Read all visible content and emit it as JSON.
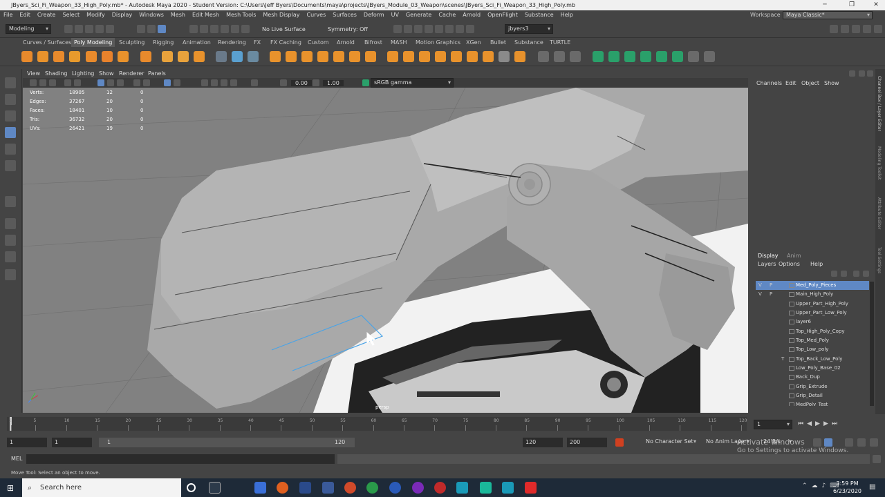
{
  "window": {
    "title": "JByers_Sci_Fi_Weapon_33_High_Poly.mb* - Autodesk Maya 2020 - Student Version: C:\\Users\\Jeff Byers\\Documents\\maya\\projects\\JByers_Module_03_Weapon\\scenes\\JByers_Sci_Fi_Weapon_33_High_Poly.mb",
    "minimize": "─",
    "maximize": "❐",
    "close": "✕"
  },
  "menu": [
    "File",
    "Edit",
    "Create",
    "Select",
    "Modify",
    "Display",
    "Windows",
    "Mesh",
    "Edit Mesh",
    "Mesh Tools",
    "Mesh Display",
    "Curves",
    "Surfaces",
    "Deform",
    "UV",
    "Generate",
    "Cache",
    "Arnold",
    "OpenFlight",
    "Substance",
    "Help"
  ],
  "workspace": {
    "label": "Workspace :",
    "value": "Maya Classic*"
  },
  "statusline": {
    "mode": "Modeling",
    "live_surface": "No Live Surface",
    "symmetry": "Symmetry: Off",
    "user": "jbyers3"
  },
  "shelf_tabs": [
    "Curves / Surfaces",
    "Poly Modeling",
    "Sculpting",
    "Rigging",
    "Animation",
    "Rendering",
    "FX",
    "FX Caching",
    "Custom",
    "Arnold",
    "Bifrost",
    "MASH",
    "Motion Graphics",
    "XGen",
    "Bullet",
    "Substance",
    "TURTLE"
  ],
  "panel_menu": [
    "View",
    "Shading",
    "Lighting",
    "Show",
    "Renderer",
    "Panels"
  ],
  "panel_tools": {
    "field1": "0.00",
    "field2": "1.00",
    "colorspace": "sRGB gamma"
  },
  "hud": [
    {
      "label": "Verts:",
      "a": "18905",
      "b": "12",
      "c": "0"
    },
    {
      "label": "Edges:",
      "a": "37267",
      "b": "20",
      "c": "0"
    },
    {
      "label": "Faces:",
      "a": "18401",
      "b": "10",
      "c": "0"
    },
    {
      "label": "Tris:",
      "a": "36732",
      "b": "20",
      "c": "0"
    },
    {
      "label": "UVs:",
      "a": "26421",
      "b": "19",
      "c": "0"
    }
  ],
  "camera_label": "persp",
  "channel_box": {
    "menu": [
      "Channels",
      "Edit",
      "Object",
      "Show"
    ]
  },
  "side_tabs": [
    "Channel Box / Layer Editor",
    "Modeling Toolkit",
    "Attribute Editor",
    "Tool Settings"
  ],
  "layer_editor": {
    "tabs": [
      "Display",
      "Anim"
    ],
    "menu": [
      "Layers",
      "Options",
      "Help"
    ],
    "layers": [
      {
        "v": "V",
        "p": "P",
        "t": "",
        "name": "Med_Poly_Pieces",
        "selected": true
      },
      {
        "v": "V",
        "p": "P",
        "t": "",
        "name": "Main_High_Poly"
      },
      {
        "v": "",
        "p": "",
        "t": "",
        "name": "Upper_Part_High_Poly"
      },
      {
        "v": "",
        "p": "",
        "t": "",
        "name": "Upper_Part_Low_Poly"
      },
      {
        "v": "",
        "p": "",
        "t": "",
        "name": "layer6"
      },
      {
        "v": "",
        "p": "",
        "t": "",
        "name": "Top_High_Poly_Copy"
      },
      {
        "v": "",
        "p": "",
        "t": "",
        "name": "Top_Med_Poly"
      },
      {
        "v": "",
        "p": "",
        "t": "",
        "name": "Top_Low_poly"
      },
      {
        "v": "",
        "p": "",
        "t": "T",
        "name": "Top_Back_Low_Poly"
      },
      {
        "v": "",
        "p": "",
        "t": "",
        "name": "Low_Poly_Base_02"
      },
      {
        "v": "",
        "p": "",
        "t": "",
        "name": "Back_Dup"
      },
      {
        "v": "",
        "p": "",
        "t": "",
        "name": "Grip_Extrude"
      },
      {
        "v": "",
        "p": "",
        "t": "",
        "name": "Grip_Detail"
      },
      {
        "v": "",
        "p": "",
        "t": "",
        "name": "MedPoly_Test"
      }
    ]
  },
  "timeline": {
    "ticks": [
      "1",
      "5",
      "10",
      "15",
      "20",
      "25",
      "30",
      "35",
      "40",
      "45",
      "50",
      "55",
      "60",
      "65",
      "70",
      "75",
      "80",
      "85",
      "90",
      "95",
      "100",
      "105",
      "110",
      "115",
      "120"
    ],
    "current": "1"
  },
  "range": {
    "start": "1",
    "start2": "1",
    "slider_start": "1",
    "slider_end": "120",
    "end": "120",
    "end2": "200",
    "character_set": "No Character Set",
    "anim_layer": "No Anim Layer",
    "fps": "24 fps"
  },
  "cmdline": {
    "label": "MEL"
  },
  "helpline": "Move Tool: Select an object to move.",
  "watermark": {
    "line1": "Activate Windows",
    "line2": "Go to Settings to activate Windows."
  },
  "taskbar": {
    "search": "Search here",
    "time": "3:59 PM",
    "date": "6/23/2020"
  }
}
